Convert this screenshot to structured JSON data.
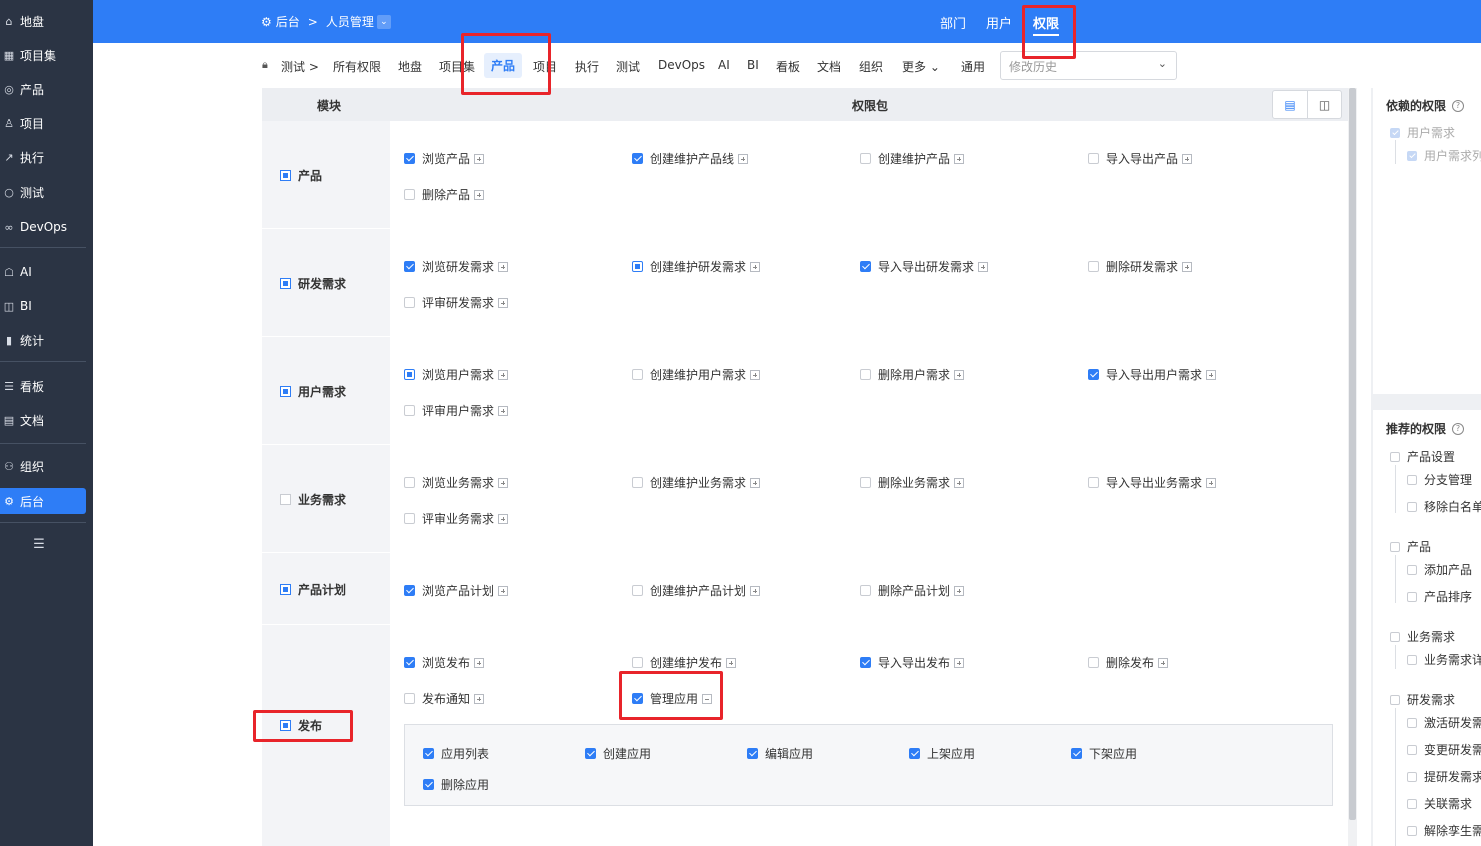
{
  "sidebar": {
    "items": [
      {
        "label": "地盘",
        "icon": "home-icon"
      },
      {
        "label": "项目集",
        "icon": "grid-icon"
      },
      {
        "label": "产品",
        "icon": "bulb-icon"
      },
      {
        "label": "项目",
        "icon": "project-icon"
      },
      {
        "label": "执行",
        "icon": "run-icon"
      },
      {
        "label": "测试",
        "icon": "search-icon"
      },
      {
        "label": "DevOps",
        "icon": "infinity-icon"
      },
      {
        "label": "AI",
        "icon": "robot-icon"
      },
      {
        "label": "BI",
        "icon": "chart-icon"
      },
      {
        "label": "统计",
        "icon": "bar-chart-icon"
      },
      {
        "label": "看板",
        "icon": "kanban-icon"
      },
      {
        "label": "文档",
        "icon": "doc-icon"
      },
      {
        "label": "组织",
        "icon": "people-icon"
      },
      {
        "label": "后台",
        "icon": "gear-icon"
      }
    ],
    "active_index": 13
  },
  "topbar": {
    "breadcrumb": [
      "后台",
      "人员管理"
    ],
    "nav": [
      "部门",
      "用户",
      "权限"
    ],
    "active_nav": "权限"
  },
  "subnav": {
    "root": "测试",
    "items": [
      "所有权限",
      "地盘",
      "项目集",
      "产品",
      "项目",
      "执行",
      "测试",
      "DevOps",
      "AI",
      "BI",
      "看板",
      "文档",
      "组织",
      "更多",
      "通用"
    ],
    "active": "产品",
    "history_placeholder": "修改历史"
  },
  "table": {
    "col_module": "模块",
    "col_perm": "权限包",
    "modules": [
      {
        "name": "产品",
        "state": "partial",
        "perms": [
          {
            "label": "浏览产品",
            "checked": true
          },
          {
            "label": "创建维护产品线",
            "checked": true
          },
          {
            "label": "创建维护产品",
            "checked": false
          },
          {
            "label": "导入导出产品",
            "checked": false
          },
          {
            "label": "删除产品",
            "checked": false
          }
        ]
      },
      {
        "name": "研发需求",
        "state": "partial",
        "perms": [
          {
            "label": "浏览研发需求",
            "checked": true
          },
          {
            "label": "创建维护研发需求",
            "checked": "partial"
          },
          {
            "label": "导入导出研发需求",
            "checked": true
          },
          {
            "label": "删除研发需求",
            "checked": false
          },
          {
            "label": "评审研发需求",
            "checked": false
          }
        ]
      },
      {
        "name": "用户需求",
        "state": "partial",
        "perms": [
          {
            "label": "浏览用户需求",
            "checked": "partial"
          },
          {
            "label": "创建维护用户需求",
            "checked": false
          },
          {
            "label": "删除用户需求",
            "checked": false
          },
          {
            "label": "导入导出用户需求",
            "checked": true
          },
          {
            "label": "评审用户需求",
            "checked": false
          }
        ]
      },
      {
        "name": "业务需求",
        "state": "none",
        "perms": [
          {
            "label": "浏览业务需求",
            "checked": false
          },
          {
            "label": "创建维护业务需求",
            "checked": false
          },
          {
            "label": "删除业务需求",
            "checked": false
          },
          {
            "label": "导入导出业务需求",
            "checked": false
          },
          {
            "label": "评审业务需求",
            "checked": false
          }
        ]
      },
      {
        "name": "产品计划",
        "state": "partial",
        "perms": [
          {
            "label": "浏览产品计划",
            "checked": true
          },
          {
            "label": "创建维护产品计划",
            "checked": false
          },
          {
            "label": "删除产品计划",
            "checked": false
          }
        ]
      },
      {
        "name": "发布",
        "state": "partial",
        "perms": [
          {
            "label": "浏览发布",
            "checked": true
          },
          {
            "label": "创建维护发布",
            "checked": false
          },
          {
            "label": "导入导出发布",
            "checked": true
          },
          {
            "label": "删除发布",
            "checked": false
          },
          {
            "label": "发布通知",
            "checked": false
          },
          {
            "label": "管理应用",
            "checked": true,
            "expanded": true
          }
        ]
      }
    ],
    "sub_perms": [
      {
        "label": "应用列表",
        "checked": true
      },
      {
        "label": "创建应用",
        "checked": true
      },
      {
        "label": "编辑应用",
        "checked": true
      },
      {
        "label": "上架应用",
        "checked": true
      },
      {
        "label": "下架应用",
        "checked": true
      },
      {
        "label": "删除应用",
        "checked": true
      }
    ]
  },
  "right_panel": {
    "depends_title": "依赖的权限",
    "depends_items": [
      "用户需求",
      "用户需求列"
    ],
    "recommend_title": "推荐的权限",
    "recommend_groups": [
      {
        "name": "产品设置",
        "children": [
          "分支管理",
          "移除白名单"
        ]
      },
      {
        "name": "产品",
        "children": [
          "添加产品",
          "产品排序"
        ]
      },
      {
        "name": "业务需求",
        "children": [
          "业务需求详"
        ]
      },
      {
        "name": "研发需求",
        "children": [
          "激活研发需",
          "变更研发需",
          "提研发需求",
          "关联需求",
          "解除孪生需"
        ]
      }
    ]
  }
}
